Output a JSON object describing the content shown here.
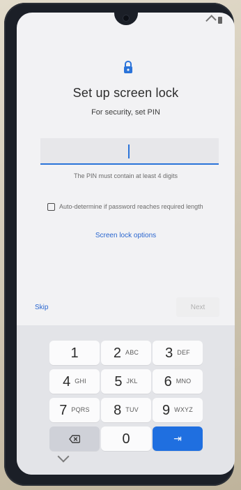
{
  "screen": {
    "title": "Set up screen lock",
    "subtitle": "For security, set PIN",
    "pin_input": {
      "value": "",
      "placeholder": ""
    },
    "pin_hint": "The PIN must contain at least 4 digits",
    "checkbox_label": "Auto-determine if password reaches required length",
    "screen_lock_options": "Screen lock options",
    "skip_label": "Skip",
    "next_label": "Next"
  },
  "keypad": {
    "keys": [
      {
        "digit": "1",
        "letters": ""
      },
      {
        "digit": "2",
        "letters": "ABC"
      },
      {
        "digit": "3",
        "letters": "DEF"
      },
      {
        "digit": "4",
        "letters": "GHI"
      },
      {
        "digit": "5",
        "letters": "JKL"
      },
      {
        "digit": "6",
        "letters": "MNO"
      },
      {
        "digit": "7",
        "letters": "PQRS"
      },
      {
        "digit": "8",
        "letters": "TUV"
      },
      {
        "digit": "9",
        "letters": "WXYZ"
      }
    ],
    "zero": "0",
    "enter_glyph": "⇥",
    "backspace_icon": "backspace-icon"
  },
  "colors": {
    "accent": "#1F6FE0",
    "link": "#2A66CF"
  },
  "icons": {
    "lock": "lock-icon",
    "chevron": "chevron-down-icon"
  }
}
